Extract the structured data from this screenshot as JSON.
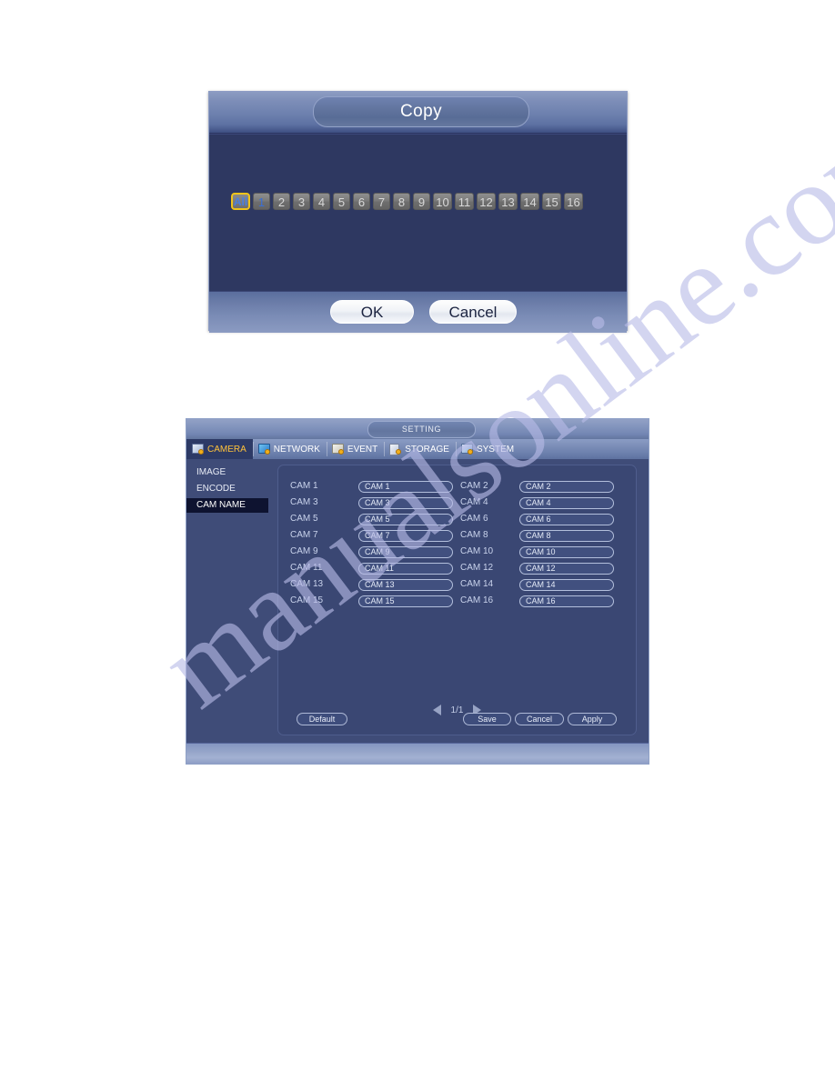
{
  "watermark": {
    "text": "manualsonline.com"
  },
  "copy_dialog": {
    "title": "Copy",
    "all_label": "All",
    "channels": [
      "1",
      "2",
      "3",
      "4",
      "5",
      "6",
      "7",
      "8",
      "9",
      "10",
      "11",
      "12",
      "13",
      "14",
      "15",
      "16"
    ],
    "selected_channels": [
      "1"
    ],
    "ok_label": "OK",
    "cancel_label": "Cancel",
    "accent_border": "#f0c419",
    "selected_color": "#3b6fd4"
  },
  "setting_window": {
    "title": "SETTING",
    "tabs": [
      {
        "label": "CAMERA",
        "icon": "camera-gear-icon",
        "active": true
      },
      {
        "label": "NETWORK",
        "icon": "network-gear-icon",
        "active": false
      },
      {
        "label": "EVENT",
        "icon": "event-gear-icon",
        "active": false
      },
      {
        "label": "STORAGE",
        "icon": "storage-gear-icon",
        "active": false
      },
      {
        "label": "SYSTEM",
        "icon": "system-gear-icon",
        "active": false
      }
    ],
    "active_tab_color": "#ffc23a",
    "sidebar": {
      "items": [
        {
          "label": "IMAGE",
          "active": false
        },
        {
          "label": "ENCODE",
          "active": false
        },
        {
          "label": "CAM NAME",
          "active": true
        }
      ]
    },
    "cam_rows": [
      {
        "left_label": "CAM 1",
        "left_value": "CAM 1",
        "right_label": "CAM 2",
        "right_value": "CAM 2"
      },
      {
        "left_label": "CAM 3",
        "left_value": "CAM 3",
        "right_label": "CAM 4",
        "right_value": "CAM 4"
      },
      {
        "left_label": "CAM 5",
        "left_value": "CAM 5",
        "right_label": "CAM 6",
        "right_value": "CAM 6"
      },
      {
        "left_label": "CAM 7",
        "left_value": "CAM 7",
        "right_label": "CAM 8",
        "right_value": "CAM 8"
      },
      {
        "left_label": "CAM 9",
        "left_value": "CAM 9",
        "right_label": "CAM 10",
        "right_value": "CAM 10"
      },
      {
        "left_label": "CAM 11",
        "left_value": "CAM 11",
        "right_label": "CAM 12",
        "right_value": "CAM 12"
      },
      {
        "left_label": "CAM 13",
        "left_value": "CAM 13",
        "right_label": "CAM 14",
        "right_value": "CAM 14"
      },
      {
        "left_label": "CAM 15",
        "left_value": "CAM 15",
        "right_label": "CAM 16",
        "right_value": "CAM 16"
      }
    ],
    "pager": {
      "page_text": "1/1",
      "prev_icon": "triangle-left-icon",
      "next_icon": "triangle-right-icon"
    },
    "buttons": {
      "default_label": "Default",
      "save_label": "Save",
      "cancel_label": "Cancel",
      "apply_label": "Apply"
    }
  }
}
